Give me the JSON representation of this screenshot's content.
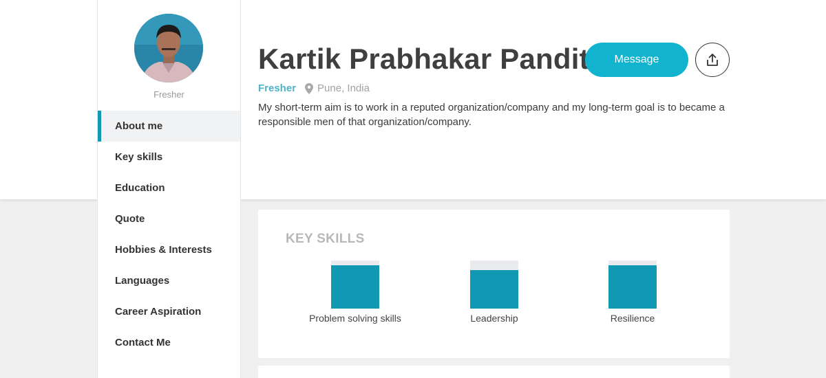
{
  "profile": {
    "name": "Kartik Prabhakar Pandit",
    "status": "Fresher",
    "location": "Pune, India",
    "bio": "My short-term aim is to work in a reputed organization/company and my long-term goal is to became a responsible men of that organization/company.",
    "avatar_caption": "Fresher"
  },
  "actions": {
    "message_label": "Message",
    "share_icon": "share-icon"
  },
  "sidebar": {
    "items": [
      {
        "label": "About me",
        "active": true
      },
      {
        "label": "Key skills",
        "active": false
      },
      {
        "label": "Education",
        "active": false
      },
      {
        "label": "Quote",
        "active": false
      },
      {
        "label": "Hobbies & Interests",
        "active": false
      },
      {
        "label": "Languages",
        "active": false
      },
      {
        "label": "Career Aspiration",
        "active": false
      },
      {
        "label": "Contact Me",
        "active": false
      }
    ]
  },
  "key_skills": {
    "title": "KEY SKILLS",
    "skills": [
      {
        "name": "Problem solving skills",
        "level": 0.9
      },
      {
        "name": "Leadership",
        "level": 0.8
      },
      {
        "name": "Resilience",
        "level": 0.9
      }
    ]
  },
  "colors": {
    "accent": "#12b3cf",
    "skill_fill": "#1198b3",
    "status_text": "#4fb3c9"
  }
}
